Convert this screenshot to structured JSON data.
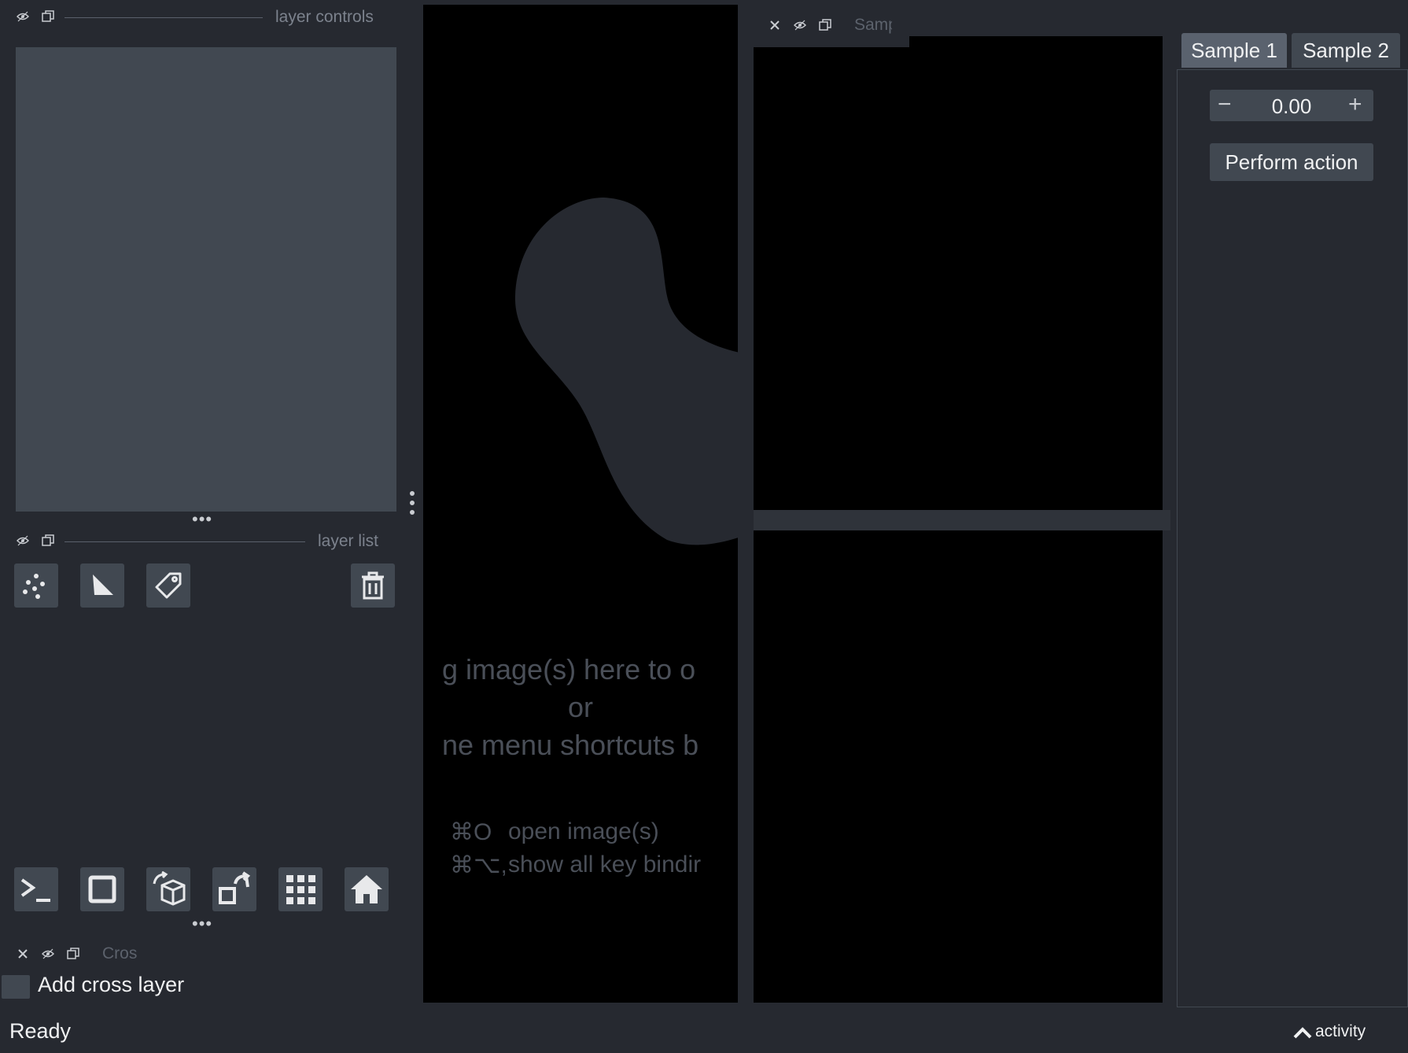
{
  "layer_controls": {
    "title": "layer controls"
  },
  "layer_list": {
    "title": "layer list"
  },
  "layer_buttons": {
    "points_icon": "points-icon",
    "shapes_icon": "shapes-icon",
    "labels_icon": "labels-icon",
    "delete_icon": "trash-icon"
  },
  "viewer_buttons": [
    "console-icon",
    "square-icon",
    "cube-rotate-icon",
    "transpose-icon",
    "grid-icon",
    "home-icon"
  ],
  "canvas": {
    "welcome_line1": "g image(s) here to o",
    "welcome_line2": "or",
    "welcome_line3": "ne menu shortcuts b",
    "shortcut1_key": "⌘O",
    "shortcut1_label": "open image(s)",
    "shortcut2_key": "⌘⌥,",
    "shortcut2_label": "show all key bindir"
  },
  "sample_dock": {
    "title": "Samp"
  },
  "tabs": [
    {
      "label": "Sample 1",
      "active": true
    },
    {
      "label": "Sample 2",
      "active": false
    }
  ],
  "spinbox": {
    "value": "0.00",
    "minus": "−",
    "plus": "+"
  },
  "perform_action": {
    "label": "Perform action"
  },
  "cross_dock": {
    "title": "Cros",
    "checkbox_label": "Add cross layer",
    "checked": false
  },
  "status": {
    "text": "Ready",
    "activity": "activity"
  },
  "colors": {
    "background": "#262930",
    "button": "#414851",
    "canvas": "#000000",
    "blob": "#262930"
  }
}
